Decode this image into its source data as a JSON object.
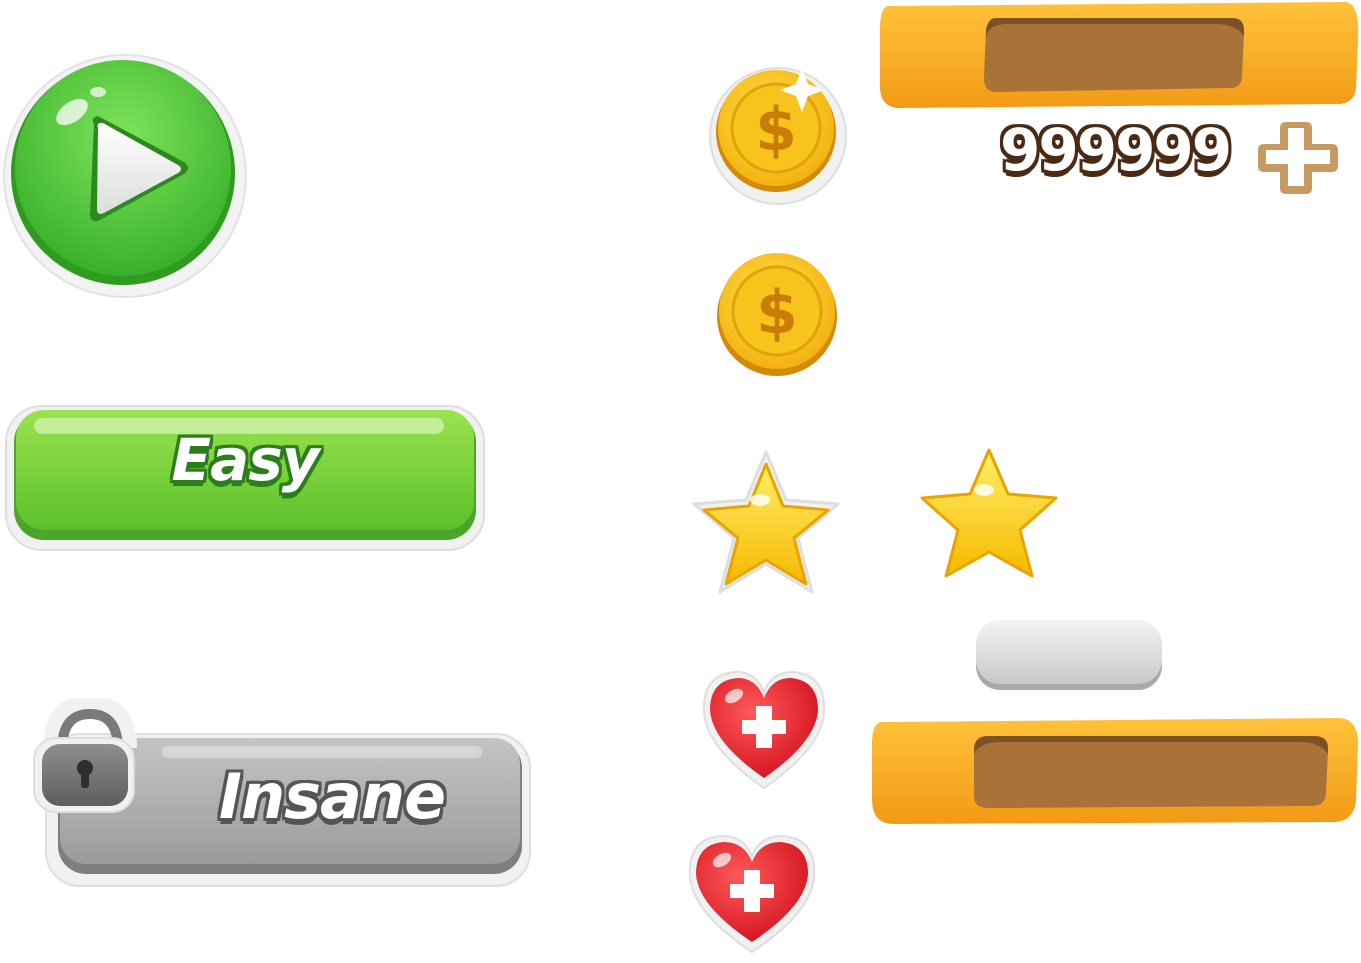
{
  "buttons": {
    "easy_label": "Easy",
    "insane_label": "Insane"
  },
  "currency": {
    "coin_count": "999999"
  },
  "icons": {
    "play": "play-icon",
    "lock": "lock-icon",
    "coin": "coin-icon",
    "star": "star-icon",
    "heart": "heart-plus-icon",
    "plus": "plus-icon"
  },
  "colors": {
    "green_main": "#5fcf3c",
    "green_dark": "#2c7e1c",
    "gray_main": "#a9a9a9",
    "orange_main": "#f6a823",
    "brown_inner": "#a87238",
    "coin_gold": "#f7c41b",
    "star_yellow": "#ffd81a",
    "heart_red": "#e4202b"
  }
}
